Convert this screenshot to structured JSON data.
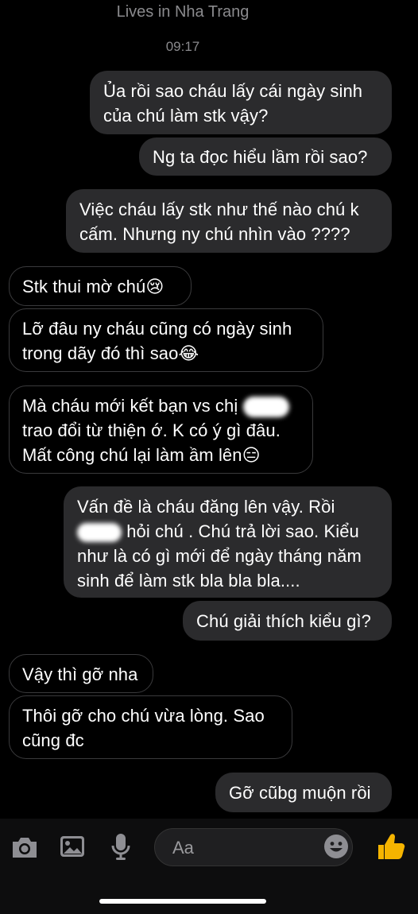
{
  "header": {
    "subtitle": "Lives in Nha Trang",
    "time": "09:17"
  },
  "messages": {
    "m1_line1": "Ủa rồi sao cháu lấy cái ngày sinh",
    "m1_line2": "của chú làm stk vậy?",
    "m2": "Ng ta đọc hiểu lầm rồi sao?",
    "m3_line1": "Việc cháu lấy stk như thế nào chú k",
    "m3_line2": "cấm. Nhưng ny chú nhìn vào ????",
    "m4": "Stk thui mờ chú",
    "m4_emoji": "😢",
    "m5_line1": "Lỡ đâu ny cháu cũng có ngày sinh",
    "m5_line2": "trong dãy đó thì sao",
    "m5_emoji": "😂",
    "m6_line1": "Mà cháu mới kết bạn vs chị",
    "m6_line2": "trao đổi từ thiện ớ. K có ý gì đâu.",
    "m6_line3": "Mất công chú lại làm ầm lên",
    "m6_emoji": "😑",
    "m7_line1": "Vấn đề là cháu đăng lên vậy. Rồi",
    "m7_line2": "hỏi chú . Chú trả lời sao. Kiểu",
    "m7_line3": "như là có gì mới để ngày tháng năm",
    "m7_line4": "sinh để làm stk bla bla bla....",
    "m8": "Chú giải thích kiểu gì?",
    "m9": "Vậy thì gỡ nha",
    "m10_line1": "Thôi gỡ cho chú vừa lòng. Sao",
    "m10_line2": "cũng đc",
    "m11": "Gỡ cũbg muộn rồi"
  },
  "composer": {
    "placeholder": "Aa"
  },
  "icons": [
    "camera-icon",
    "gallery-icon",
    "microphone-icon",
    "smiley-icon",
    "thumbs-up-icon"
  ],
  "colors": {
    "sent_bubble": "#2b2b2d",
    "received_border": "#3a3a3c",
    "background": "#000000",
    "like_yellow": "#f5b400"
  }
}
